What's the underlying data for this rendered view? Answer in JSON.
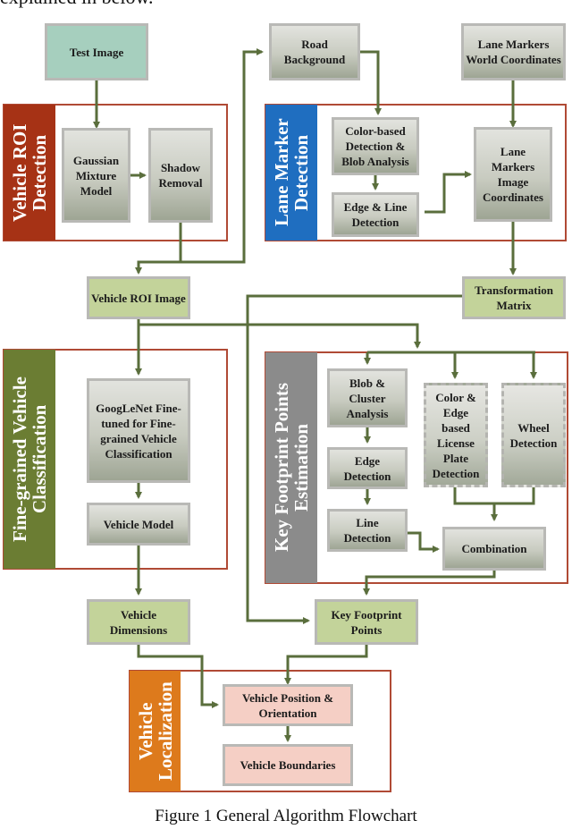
{
  "top_text": "explained in below.",
  "caption": "Figure 1 General Algorithm Flowchart",
  "colors": {
    "wire": "#5a6e3c",
    "group_border": "#b04a35",
    "vehicle_roi_band": "#a63215",
    "lane_marker_band": "#1f6ec0",
    "classification_band": "#6b7d33",
    "footprint_band": "#8b8b8b",
    "localization_band": "#dd7a1c"
  },
  "groups": {
    "vehicle_roi": "Vehicle ROI Detection",
    "lane_marker": "Lane Marker Detection",
    "classification": "Fine-grained Vehicle Classification",
    "footprint": "Key Footprint Points Estimation",
    "localization": "Vehicle Localization"
  },
  "nodes": {
    "test_image": "Test Image",
    "gmm": "Gaussian Mixture Model",
    "shadow_removal": "Shadow Removal",
    "road_background": "Road Background",
    "lane_markers_world": "Lane Markers World Coordinates",
    "color_blob": "Color-based Detection & Blob Analysis",
    "edge_line": "Edge & Line Detection",
    "lane_markers_image": "Lane Markers Image Coordinates",
    "vehicle_roi_image": "Vehicle ROI Image",
    "transformation_matrix": "Transformation Matrix",
    "googlenet": "GoogLeNet Fine-tuned for Fine-grained Vehicle Classification",
    "vehicle_model": "Vehicle Model",
    "blob_cluster": "Blob & Cluster Analysis",
    "license_plate": "Color & Edge based License Plate Detection",
    "wheel_detection": "Wheel Detection",
    "edge_detection": "Edge Detection",
    "line_detection": "Line Detection",
    "combination": "Combination",
    "vehicle_dimensions": "Vehicle Dimensions",
    "key_footprint_points": "Key Footprint Points",
    "position_orientation": "Vehicle Position & Orientation",
    "vehicle_boundaries": "Vehicle Boundaries"
  }
}
